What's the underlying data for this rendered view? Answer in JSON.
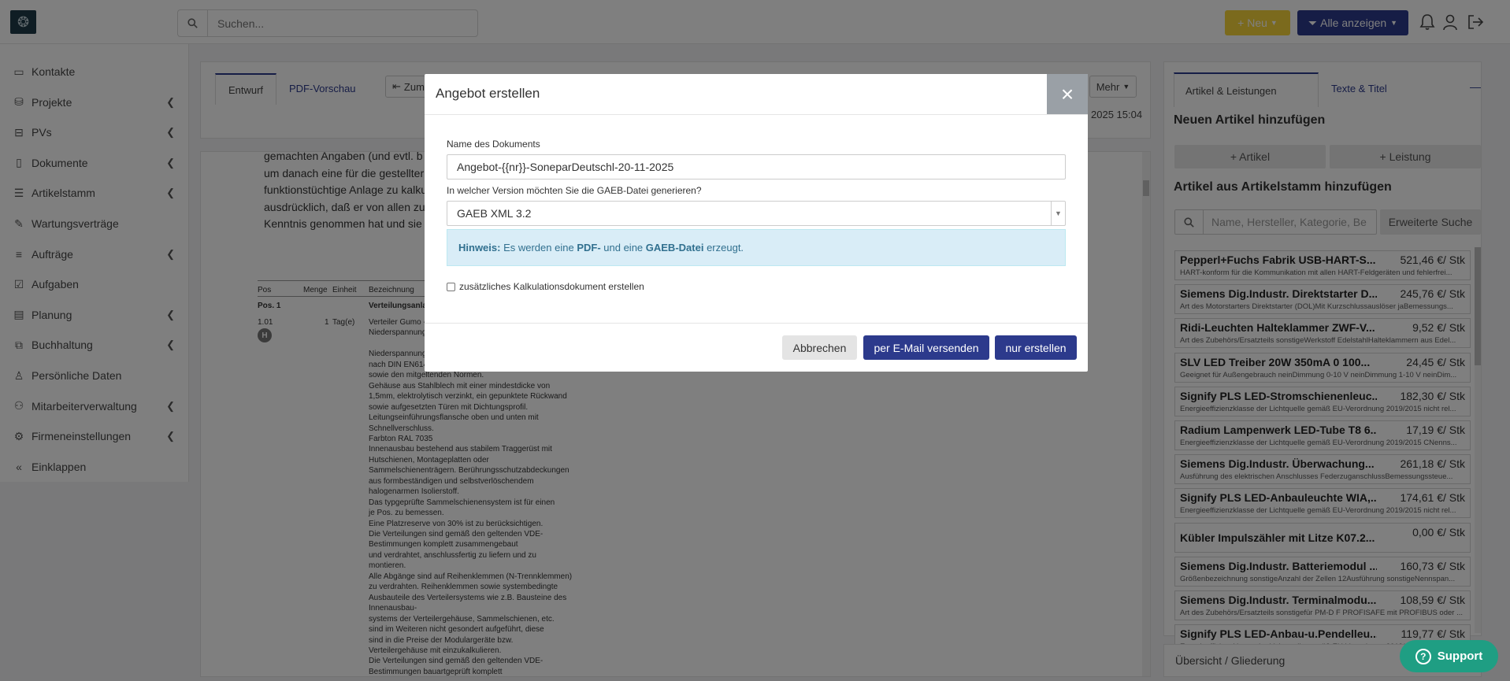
{
  "topbar": {
    "search_placeholder": "Suchen...",
    "new_label": "+ Neu",
    "show_all_label": "Alle anzeigen"
  },
  "sidebar": {
    "items": [
      {
        "label": "Kontakte",
        "icon": "contacts-icon",
        "chevron": false
      },
      {
        "label": "Projekte",
        "icon": "projects-icon",
        "chevron": true
      },
      {
        "label": "PVs",
        "icon": "pv-icon",
        "chevron": true
      },
      {
        "label": "Dokumente",
        "icon": "documents-icon",
        "chevron": true
      },
      {
        "label": "Artikelstamm",
        "icon": "articles-icon",
        "chevron": true
      },
      {
        "label": "Wartungsverträge",
        "icon": "contracts-icon",
        "chevron": false
      },
      {
        "label": "Aufträge",
        "icon": "orders-icon",
        "chevron": true
      },
      {
        "label": "Aufgaben",
        "icon": "tasks-icon",
        "chevron": false
      },
      {
        "label": "Planung",
        "icon": "planning-icon",
        "chevron": true
      },
      {
        "label": "Buchhaltung",
        "icon": "accounting-icon",
        "chevron": true
      },
      {
        "label": "Persönliche Daten",
        "icon": "user-icon",
        "chevron": false
      },
      {
        "label": "Mitarbeiterverwaltung",
        "icon": "employees-icon",
        "chevron": true
      },
      {
        "label": "Firmeneinstellungen",
        "icon": "gear-icon",
        "chevron": true
      },
      {
        "label": "Einklappen",
        "icon": "collapse-icon",
        "chevron": false
      }
    ]
  },
  "editor": {
    "tab_draft": "Entwurf",
    "tab_pdf": "PDF-Vorschau",
    "back_label": "Zum",
    "more_label": "Mehr",
    "timestamp": "2025 15:04",
    "text_lines": [
      "gemachten Angaben (und evtl. b",
      "um danach eine für die gestellter",
      "funktionstüchtige Anlage zu kalku",
      "ausdrücklich, daß er von allen zu",
      "Kenntnis genommen hat und sie"
    ],
    "table_headers": {
      "pos": "Pos",
      "menge": "Menge",
      "einheit": "Einheit",
      "bezeichnung": "Bezeichnung"
    },
    "group_pos": "Pos. 1",
    "group_label": "Verteilungsanla",
    "item_pos": "1.01",
    "item_badge": "H",
    "item_qty": "1",
    "item_unit": "Tag(e)",
    "item_lines": [
      "Verteiler Gumo -",
      "Niederspannung",
      "",
      "Niederspannung",
      "nach DIN EN614",
      "sowie den mitgeltenden Normen.",
      "Gehäuse aus Stahlblech mit einer mindestdicke von",
      "1,5mm, elektrolytisch verzinkt, ein gepunktete Rückwand",
      "sowie aufgesetzten Türen mit Dichtungsprofil.",
      "Leitungseinführungsflansche oben und unten mit",
      "Schnellverschluss.",
      "Farbton RAL 7035",
      "Innenausbau bestehend aus stabilem Traggerüst mit",
      "Hutschienen, Montageplatten oder",
      "Sammelschienenträgern. Berührungsschutzabdeckungen",
      "aus formbeständigen und selbstverlöschendem",
      "halogenarmen Isolierstoff.",
      "Das typgeprüfte Sammelschienensystem ist für einen",
      "je Pos. zu bemessen.",
      "Eine Platzreserve von 30% ist zu berücksichtigen.",
      "Die Verteilungen sind gemäß den geltenden VDE-",
      "Bestimmungen komplett zusammengebaut",
      "und verdrahtet, anschlussfertig zu liefern und zu",
      "montieren.",
      "Alle Abgänge sind auf Reihenklemmen (N-Trennklemmen)",
      "zu verdrahten. Reihenklemmen sowie systembedingte",
      "Ausbauteile des Verteilersystems wie z.B. Bausteine des",
      "Innenausbau-",
      "systems der Verteilergehäuse, Sammelschienen, etc.",
      "sind im Weiteren nicht gesondert aufgeführt, diese",
      "sind in die Preise der Modulargeräte bzw.",
      "Verteilergehäuse mit einzukalkulieren.",
      "Die Verteilungen sind gemäß den geltenden VDE-",
      "Bestimmungen bauartgeprüft komplett"
    ]
  },
  "right_panel": {
    "tab_articles": "Artikel & Leistungen",
    "tab_texts": "Texte & Titel",
    "collapse_label": "—",
    "new_heading": "Neuen Artikel hinzufügen",
    "add_article": "+ Artikel",
    "add_service": "+ Leistung",
    "stock_heading": "Artikel aus Artikelstamm hinzufügen",
    "search_placeholder": "Name, Hersteller, Kategorie, Be",
    "advanced_search": "Erweiterte Suche",
    "articles": [
      {
        "name": "Pepperl+Fuchs Fabrik USB-HART-S...",
        "price": "521,46 €/ Stk",
        "desc": "HART-konform für die Kommunikation mit allen HART-Feldgeräten und fehlerfrei..."
      },
      {
        "name": "Siemens Dig.Industr. Direktstarter D...",
        "price": "245,76 €/ Stk",
        "desc": "Art des Motorstarters Direktstarter (DOL)Mit Kurzschlussauslöser jaBemessungs..."
      },
      {
        "name": "Ridi-Leuchten Halteklammer ZWF-V...",
        "price": "9,52 €/ Stk",
        "desc": "Art des Zubehörs/Ersatzteils sonstigeWerkstoff EdelstahlHalteklammern aus Edel..."
      },
      {
        "name": "SLV LED Treiber 20W 350mA 0 100...",
        "price": "24,45 €/ Stk",
        "desc": "Geeignet für Außengebrauch neinDimmung 0-10 V neinDimmung 1-10 V neinDim..."
      },
      {
        "name": "Signify PLS LED-Stromschienenleuc...",
        "price": "182,30 €/ Stk",
        "desc": "Energieeffizienzklasse der Lichtquelle gemäß EU-Verordnung 2019/2015 nicht rel..."
      },
      {
        "name": "Radium Lampenwerk LED-Tube T8 6...",
        "price": "17,19 €/ Stk",
        "desc": "Energieeffizienzklasse der Lichtquelle gemäß EU-Verordnung 2019/2015 CNenns..."
      },
      {
        "name": "Siemens Dig.Industr. Überwachung...",
        "price": "261,18 €/ Stk",
        "desc": "Ausführung des elektrischen Anschlusses FederzuganschlussBemessungssteue..."
      },
      {
        "name": "Signify PLS LED-Anbauleuchte WIA,...",
        "price": "174,61 €/ Stk",
        "desc": "Energieeffizienzklasse der Lichtquelle gemäß EU-Verordnung 2019/2015 nicht rel..."
      },
      {
        "name": "Kübler Impulszähler mit Litze K07.2...",
        "price": "0,00 €/ Stk",
        "desc": ""
      },
      {
        "name": "Siemens Dig.Industr. Batteriemodul ...",
        "price": "160,73 €/ Stk",
        "desc": "Größenbezeichnung sonstigeAnzahl der Zellen 12Ausführung sonstigeNennspan..."
      },
      {
        "name": "Siemens Dig.Industr. Terminalmodu...",
        "price": "108,59 €/ Stk",
        "desc": "Art des Zubehörs/Ersatzteils sonstigefür PM-D F PROFISAFE mit PROFIBUS oder ..."
      },
      {
        "name": "Signify PLS LED-Anbau-u.Pendelleu...",
        "price": "119,77 €/ Stk",
        "desc": "Energieeffizienzklasse der Lichtquelle gemäß EU-Verordnung 2019/2015 nicht rel..."
      }
    ],
    "overview_label": "Übersicht / Gliederung"
  },
  "modal": {
    "title": "Angebot erstellen",
    "close_label": "×",
    "name_label": "Name des Dokuments",
    "name_value": "Angebot-{{nr}}-SoneparDeutschl-20-11-2025",
    "version_label": "In welcher Version möchten Sie die GAEB-Datei generieren?",
    "version_value": "GAEB XML 3.2",
    "hint_prefix": "Hinweis:",
    "hint_text_1": " Es werden eine ",
    "hint_pdf": "PDF-",
    "hint_text_2": " und eine ",
    "hint_gaeb": "GAEB-Datei",
    "hint_text_3": " erzeugt.",
    "checkbox_label": "zusätzliches Kalkulationsdokument erstellen",
    "cancel_label": "Abbrechen",
    "email_label": "per E-Mail versenden",
    "create_label": "nur erstellen"
  },
  "support_label": "Support",
  "colors": {
    "primary": "#2c3a8c",
    "accent_yellow": "#f7d53b",
    "support_green": "#1f9e83",
    "hint_bg": "#d9edf7"
  }
}
